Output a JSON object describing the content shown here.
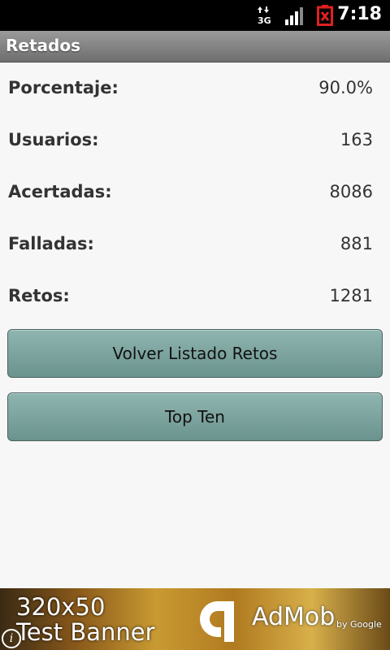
{
  "status_bar": {
    "network": "3G",
    "time": "7:18"
  },
  "title_bar": {
    "title": "Retados"
  },
  "stats": [
    {
      "label": "Porcentaje:",
      "value": "90.0%"
    },
    {
      "label": "Usuarios:",
      "value": "163"
    },
    {
      "label": "Acertadas:",
      "value": "8086"
    },
    {
      "label": "Falladas:",
      "value": "881"
    },
    {
      "label": "Retos:",
      "value": "1281"
    }
  ],
  "buttons": {
    "volver": "Volver Listado Retos",
    "top_ten": "Top Ten"
  },
  "ad": {
    "line1": "320x50",
    "line2": "Test Banner",
    "brand": "AdMob",
    "by": "by Google",
    "info": "i"
  },
  "colors": {
    "button_fill": "#7ca39e",
    "battery_alert": "#e02020"
  }
}
